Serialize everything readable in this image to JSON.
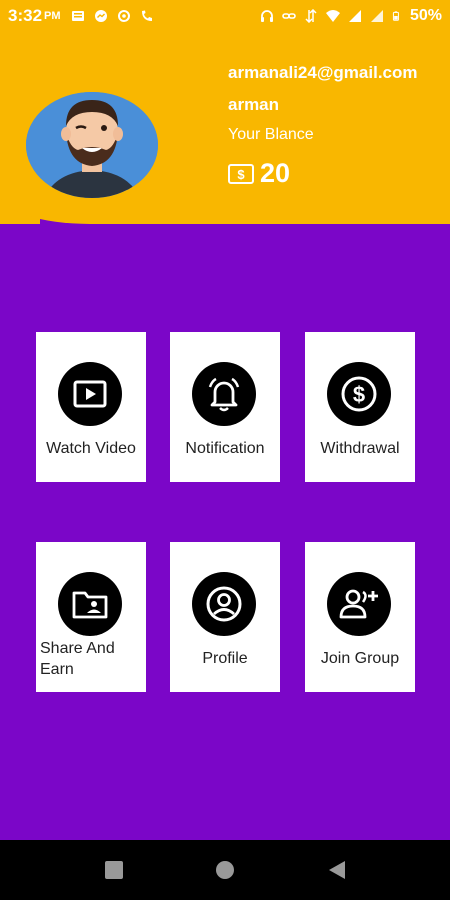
{
  "status_bar": {
    "time": "3:32",
    "ampm": "PM",
    "battery": "50%"
  },
  "user": {
    "email": "armanali24@gmail.com",
    "name": "arman",
    "balance_label": "Your Blance",
    "balance_value": "20"
  },
  "menu": [
    {
      "label": "Watch Video",
      "icon": "play-icon"
    },
    {
      "label": "Notification",
      "icon": "bell-icon"
    },
    {
      "label": "Withdrawal",
      "icon": "dollar-icon"
    },
    {
      "label": "Share And Earn",
      "icon": "folder-share-icon"
    },
    {
      "label": "Profile",
      "icon": "profile-icon"
    },
    {
      "label": "Join Group",
      "icon": "add-group-icon"
    }
  ],
  "colors": {
    "background": "#7b06c8",
    "header": "#f9b700",
    "nav_bar": "#000000"
  }
}
